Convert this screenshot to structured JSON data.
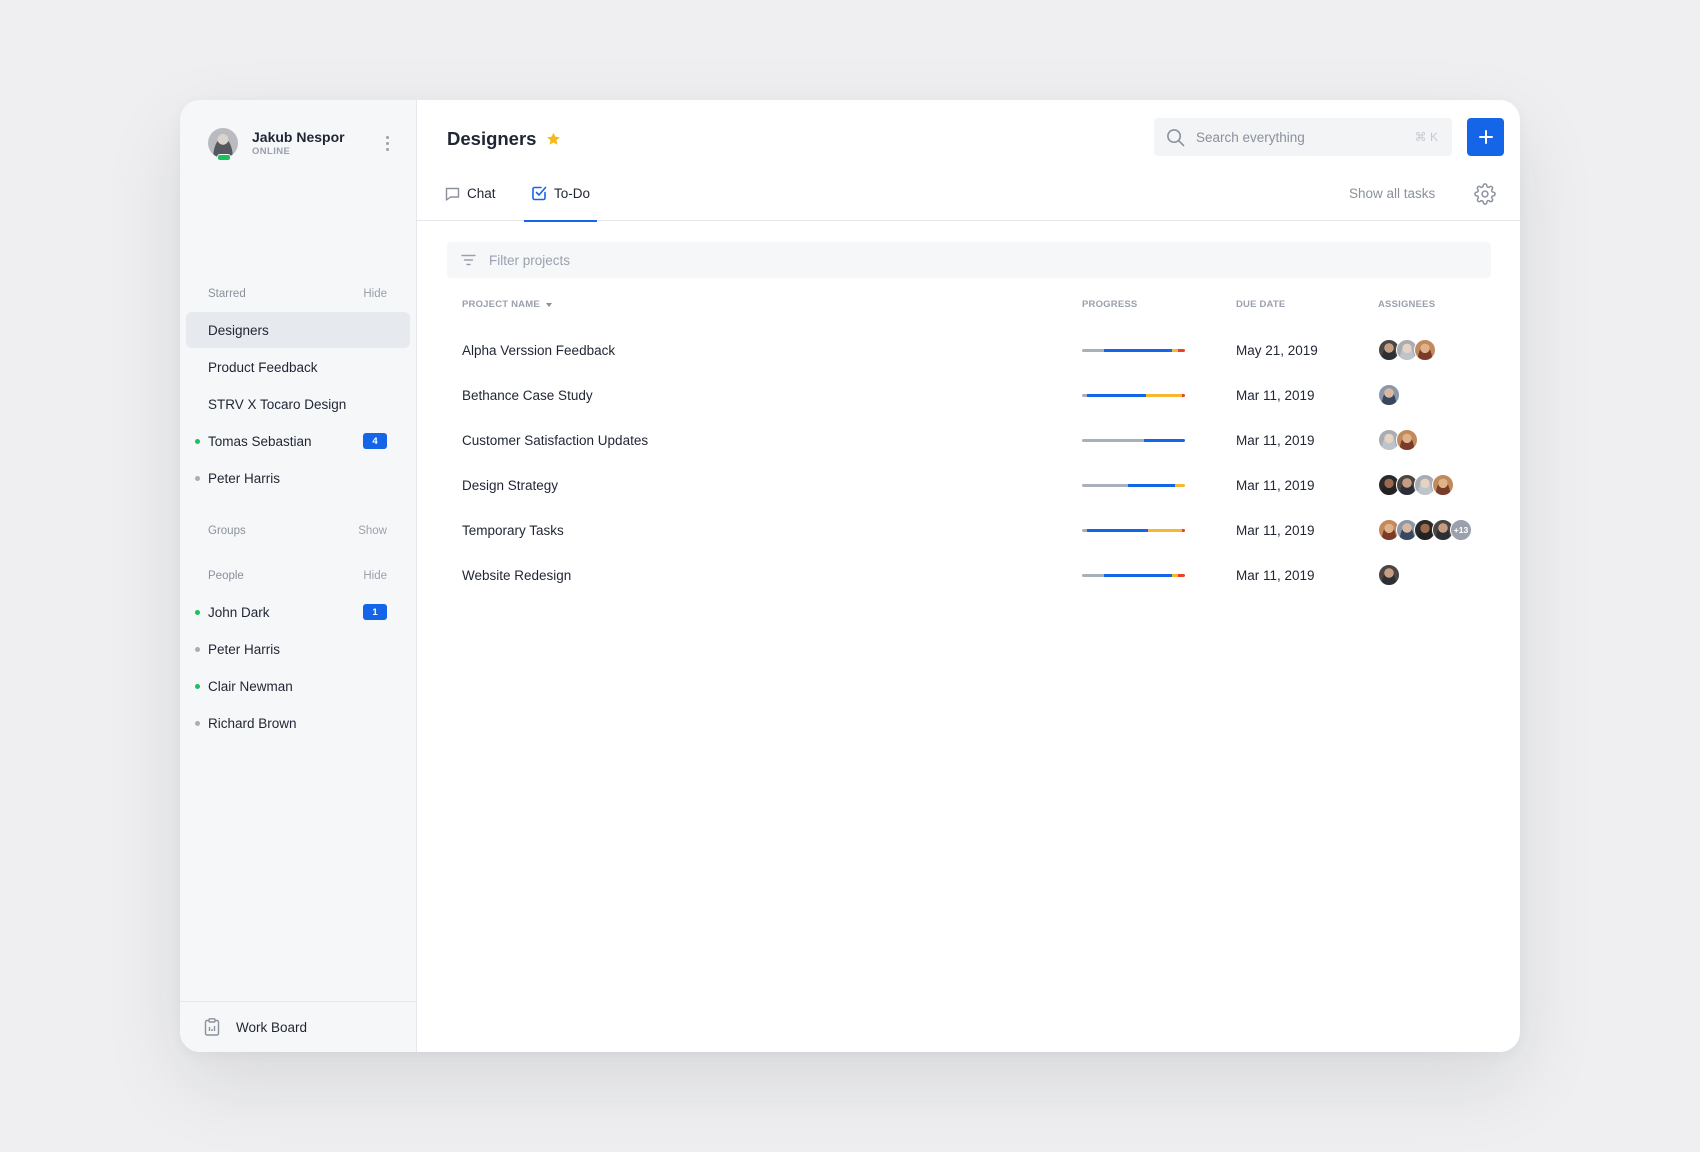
{
  "colors": {
    "accent": "#1565e8",
    "online": "#1dbf5e",
    "offline": "#a8aeb8",
    "star": "#f7b919",
    "progress_done": "#a8b0bc",
    "progress_active": "#1565e8",
    "progress_warn": "#f5b82e",
    "progress_overdue": "#e8422c"
  },
  "profile": {
    "name": "Jakub Nespor",
    "status": "ONLINE"
  },
  "sidebar": {
    "starred": {
      "heading": "Starred",
      "toggle": "Hide",
      "items": [
        {
          "label": "Designers",
          "active": true
        },
        {
          "label": "Product Feedback"
        },
        {
          "label": "STRV X Tocaro Design"
        },
        {
          "label": "Tomas Sebastian",
          "presence": "online",
          "badge": "4"
        },
        {
          "label": "Peter Harris",
          "presence": "offline"
        }
      ]
    },
    "groups": {
      "heading": "Groups",
      "toggle": "Show"
    },
    "people": {
      "heading": "People",
      "toggle": "Hide",
      "items": [
        {
          "label": "John Dark",
          "presence": "online",
          "badge": "1"
        },
        {
          "label": "Peter Harris",
          "presence": "offline"
        },
        {
          "label": "Clair Newman",
          "presence": "online"
        },
        {
          "label": "Richard Brown",
          "presence": "offline"
        }
      ]
    },
    "footer": {
      "label": "Work Board",
      "icon": "clipboard-icon"
    }
  },
  "header": {
    "title": "Designers",
    "starred": true,
    "search": {
      "placeholder": "Search everything",
      "shortcut": "⌘ K"
    },
    "add_label": "+"
  },
  "tabs": [
    {
      "label": "Chat",
      "icon": "chat-icon",
      "active": false
    },
    {
      "label": "To-Do",
      "icon": "checkbox-icon",
      "active": true
    }
  ],
  "show_all_label": "Show all tasks",
  "filter": {
    "placeholder": "Filter projects"
  },
  "table": {
    "columns": {
      "name": "PROJECT NAME",
      "progress": "PROGRESS",
      "due": "DUE DATE",
      "assignees": "ASSIGNEES"
    },
    "rows": [
      {
        "name": "Alpha Verssion Feedback",
        "due": "May 21, 2019",
        "progress": {
          "done": 20,
          "active": 62,
          "warn": 6,
          "overdue": 6
        },
        "assignees": 3
      },
      {
        "name": "Bethance Case Study",
        "due": "Mar 11, 2019",
        "progress": {
          "done": 5,
          "active": 53,
          "warn": 33,
          "overdue": 3
        },
        "assignees": 1
      },
      {
        "name": "Customer Satisfaction Updates",
        "due": "Mar 11, 2019",
        "progress": {
          "done": 60,
          "active": 40,
          "warn": 0,
          "overdue": 0
        },
        "assignees": 2
      },
      {
        "name": "Design Strategy",
        "due": "Mar 11, 2019",
        "progress": {
          "done": 45,
          "active": 45,
          "warn": 10,
          "overdue": 0
        },
        "assignees": 4
      },
      {
        "name": "Temporary Tasks",
        "due": "Mar 11, 2019",
        "progress": {
          "done": 5,
          "active": 58,
          "warn": 33,
          "overdue": 3
        },
        "assignees": 4,
        "more": "+13"
      },
      {
        "name": "Website Redesign",
        "due": "Mar 11, 2019",
        "progress": {
          "done": 20,
          "active": 62,
          "warn": 6,
          "overdue": 6
        },
        "assignees": 1
      }
    ]
  }
}
